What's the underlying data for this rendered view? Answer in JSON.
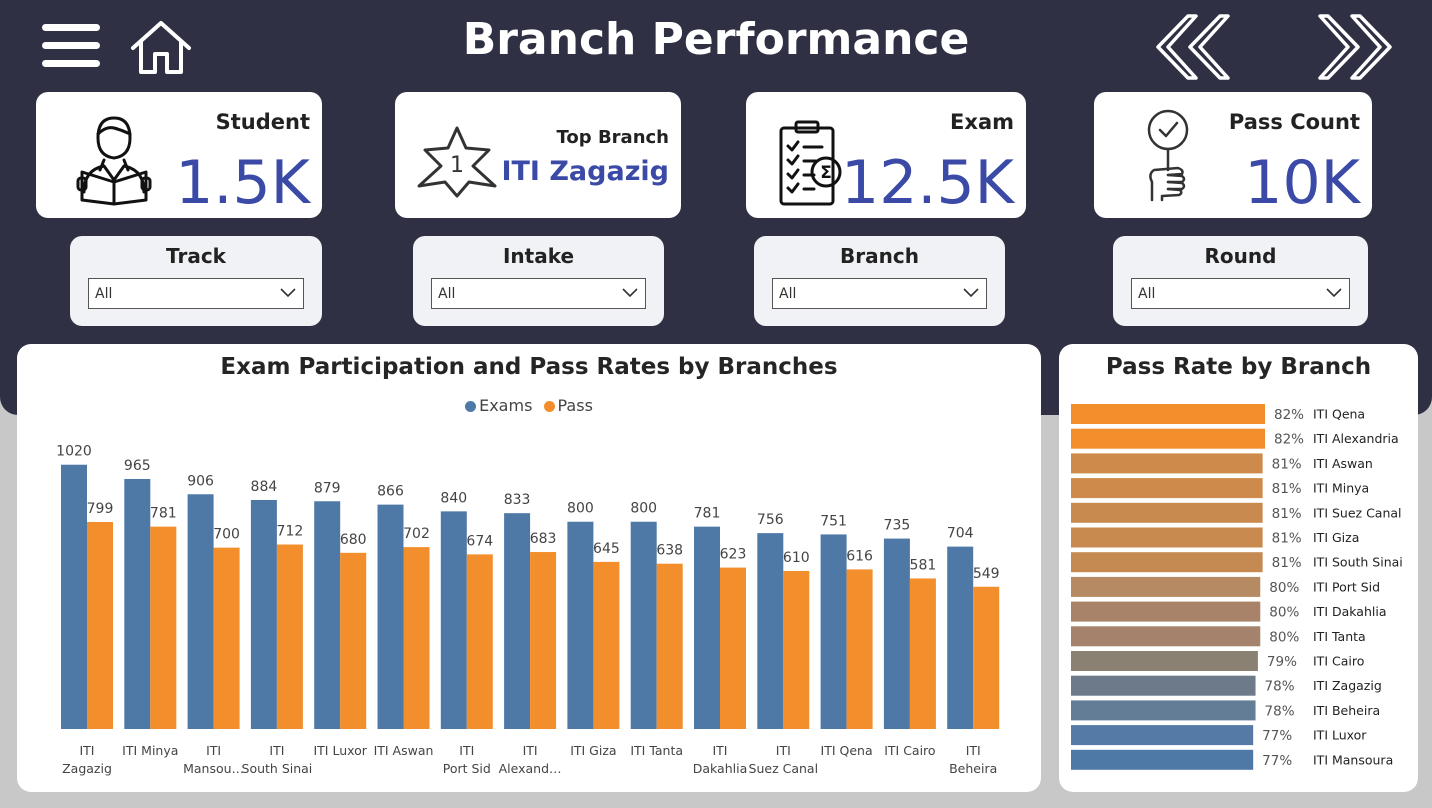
{
  "header": {
    "title": "Branch Performance",
    "menu_icon": "hamburger-icon",
    "home_icon": "home-icon",
    "back_icon": "double-chevron-left-icon",
    "forward_icon": "double-chevron-right-icon"
  },
  "kpis": {
    "student": {
      "label": "Student",
      "value": "1.5K",
      "icon": "student-reading-icon"
    },
    "top_branch": {
      "label": "Top Branch",
      "value": "ITI Zagazig",
      "icon": "star-number-one-icon"
    },
    "exam": {
      "label": "Exam",
      "value": "12.5K",
      "icon": "clipboard-checklist-icon"
    },
    "pass_count": {
      "label": "Pass Count",
      "value": "10K",
      "icon": "hand-check-sign-icon"
    }
  },
  "slicers": {
    "track": {
      "label": "Track",
      "value": "All"
    },
    "intake": {
      "label": "Intake",
      "value": "All"
    },
    "branch": {
      "label": "Branch",
      "value": "All"
    },
    "round": {
      "label": "Round",
      "value": "All"
    }
  },
  "colors": {
    "header_bg": "#2f3044",
    "kpi_value": "#3a4aa6",
    "exams": "#4e79a7",
    "pass": "#f28e2b"
  },
  "chart_data": [
    {
      "type": "bar",
      "title": "Exam Participation and Pass Rates by Branches",
      "legend_position": "top-center",
      "categories": [
        "ITI Zagazig",
        "ITI Minya",
        "ITI Mansou…",
        "ITI South Sinai",
        "ITI Luxor",
        "ITI Aswan",
        "ITI Port Sid",
        "ITI Alexand…",
        "ITI Giza",
        "ITI Tanta",
        "ITI Dakahlia",
        "ITI Suez Canal",
        "ITI Qena",
        "ITI Cairo",
        "ITI Beheira"
      ],
      "series": [
        {
          "name": "Exams",
          "color": "#4e79a7",
          "values": [
            1020,
            965,
            906,
            884,
            879,
            866,
            840,
            833,
            800,
            800,
            781,
            756,
            751,
            735,
            704
          ]
        },
        {
          "name": "Pass",
          "color": "#f28e2b",
          "values": [
            799,
            781,
            700,
            712,
            680,
            702,
            674,
            683,
            645,
            638,
            623,
            610,
            616,
            581,
            549
          ]
        }
      ],
      "ylim": [
        0,
        1100
      ],
      "grid": false,
      "data_labels": true
    },
    {
      "type": "bar",
      "orientation": "horizontal",
      "title": "Pass Rate by Branch",
      "categories": [
        "ITI Qena",
        "ITI Alexandria",
        "ITI Aswan",
        "ITI Minya",
        "ITI Suez Canal",
        "ITI Giza",
        "ITI South Sinai",
        "ITI Port Sid",
        "ITI Dakahlia",
        "ITI Tanta",
        "ITI Cairo",
        "ITI Zagazig",
        "ITI Beheira",
        "ITI Luxor",
        "ITI Mansoura"
      ],
      "values": [
        82,
        82,
        81,
        81,
        81,
        81,
        81,
        80,
        80,
        80,
        79,
        78,
        78,
        77,
        77
      ],
      "labels": [
        "82%",
        "82%",
        "81%",
        "81%",
        "81%",
        "81%",
        "81%",
        "80%",
        "80%",
        "80%",
        "79%",
        "78%",
        "78%",
        "77%",
        "77%"
      ],
      "colors": [
        "#f28e2b",
        "#f28e2b",
        "#cd8a4a",
        "#cd8a4a",
        "#c98a50",
        "#c98a50",
        "#c48a52",
        "#b68a62",
        "#a88369",
        "#a4826b",
        "#8b8172",
        "#6d7a8a",
        "#647d97",
        "#557aa5",
        "#4e79a7"
      ],
      "grid": false,
      "data_labels": true
    }
  ]
}
